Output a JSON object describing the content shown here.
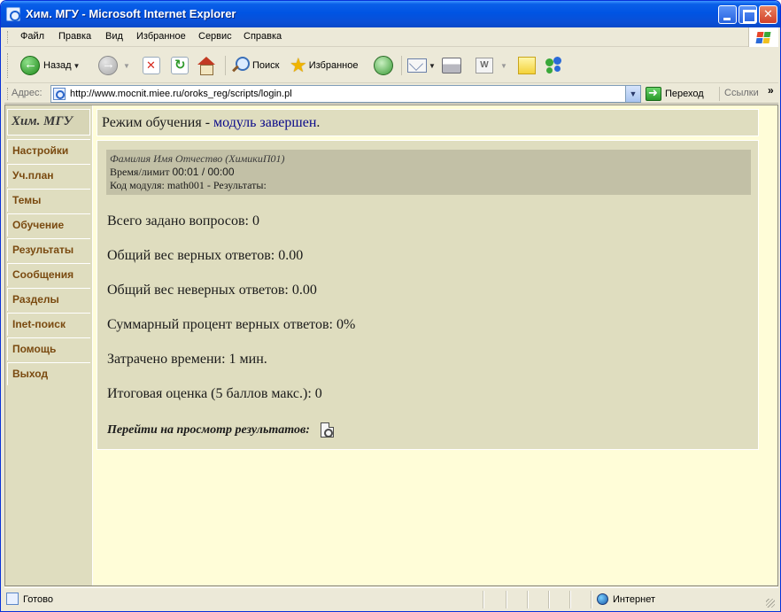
{
  "window": {
    "title": "Хим. МГУ - Microsoft Internet Explorer"
  },
  "menu": [
    "Файл",
    "Правка",
    "Вид",
    "Избранное",
    "Сервис",
    "Справка"
  ],
  "toolbar": {
    "back_label": "Назад",
    "search_label": "Поиск",
    "favorites_label": "Избранное"
  },
  "address": {
    "label": "Адрес:",
    "url": "http://www.mocnit.miee.ru/oroks_reg/scripts/login.pl",
    "go_label": "Переход",
    "links_label": "Ссылки"
  },
  "sidebar": {
    "logo": "Хим. МГУ",
    "items": [
      "Настройки",
      "Уч.план",
      "Темы",
      "Обучение",
      "Результаты",
      "Сообщения",
      "Разделы",
      "Inet-поиск",
      "Помощь",
      "Выход"
    ]
  },
  "header": {
    "prefix": "Режим обучения - ",
    "status": "модуль завершен",
    "suffix": "."
  },
  "info": {
    "name": "Фамилия Имя Отчество (ХимикиП01)",
    "time_label": "Время/лимит",
    "time_value": "00:01 / 00:00",
    "module": "Код модуля: math001 - Результаты:"
  },
  "stats": {
    "total_questions": "Всего задано вопросов: 0",
    "correct_weight": "Общий вес верных ответов: 0.00",
    "wrong_weight": "Общий вес неверных ответов: 0.00",
    "percent_correct": "Суммарный процент верных ответов: 0%",
    "time_spent": "Затрачено времени: 1 мин.",
    "final_grade": "Итоговая оценка (5 баллов макс.): 0"
  },
  "goto_label": "Перейти на просмотр результатов:",
  "status": {
    "text": "Готово",
    "zone": "Интернет"
  }
}
